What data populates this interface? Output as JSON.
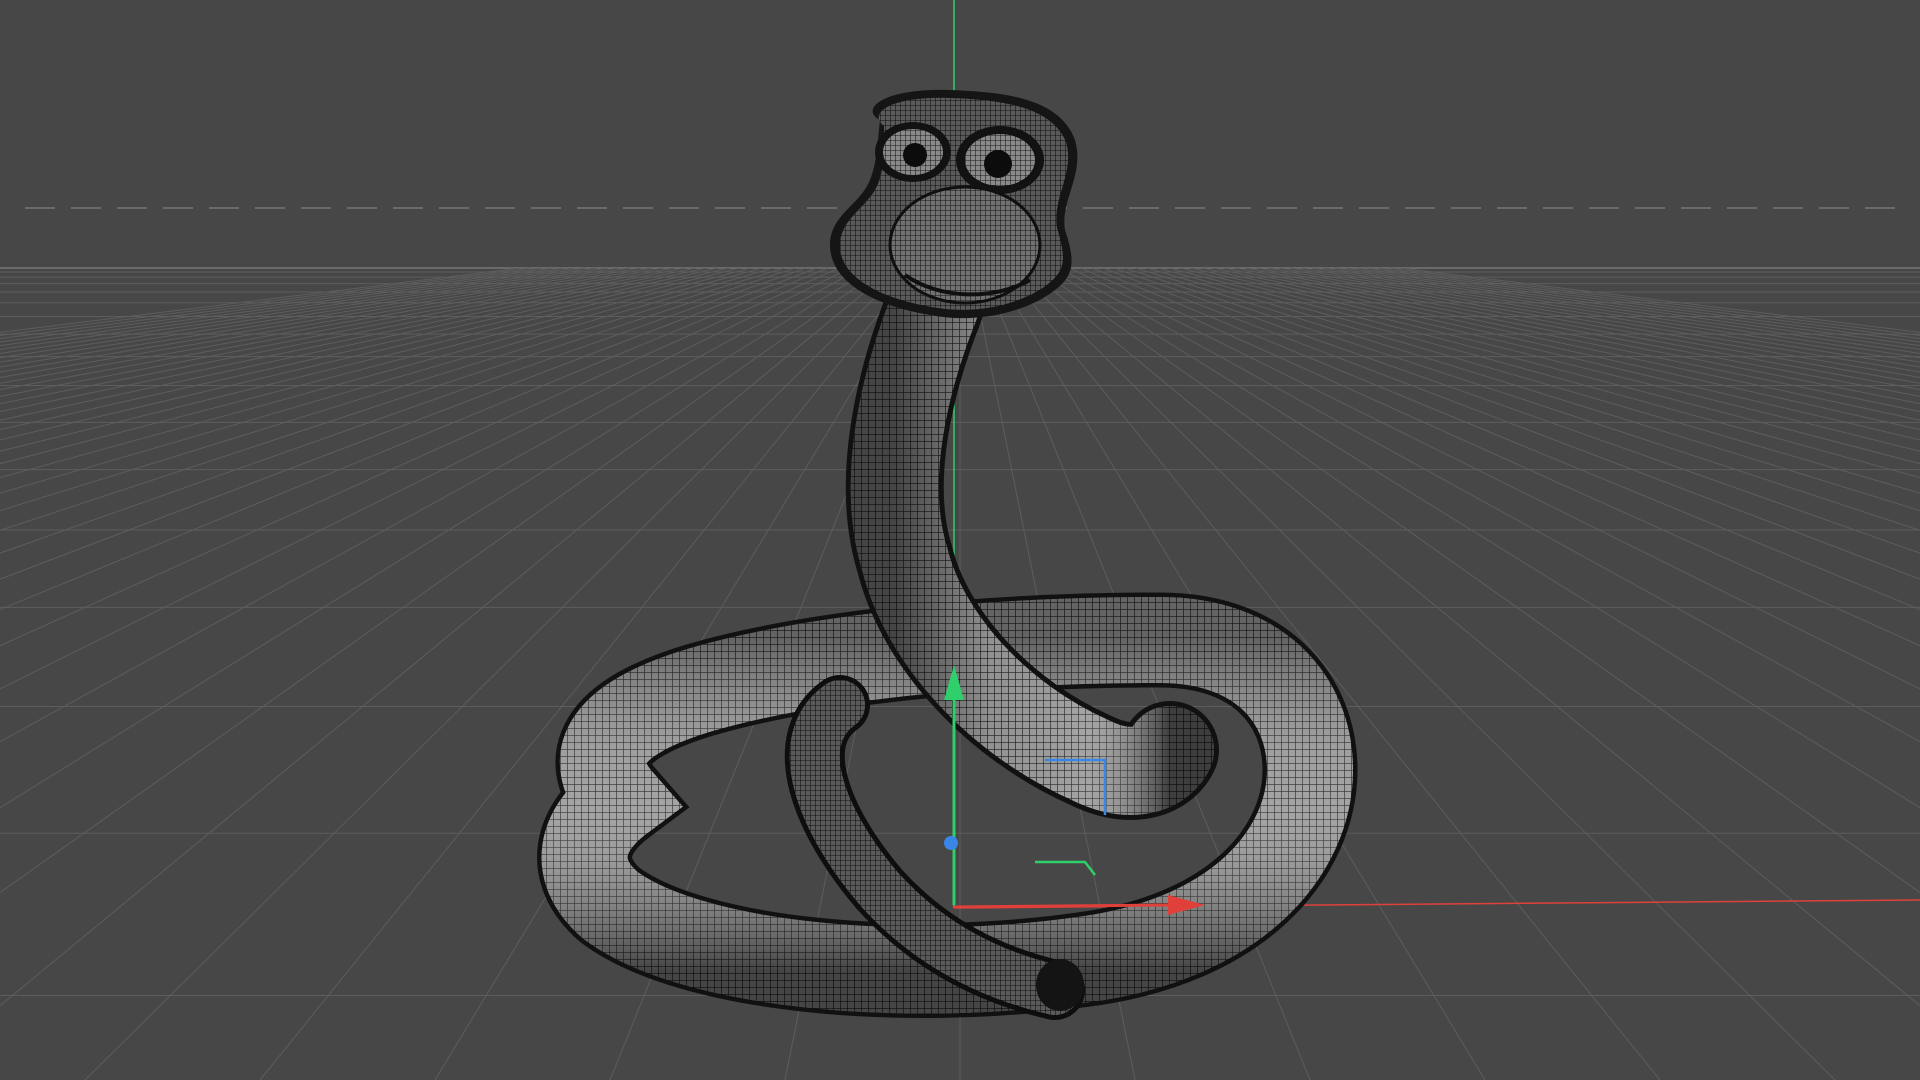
{
  "viewport": {
    "background": "#474747",
    "grid_color": "#5d5d5d",
    "horizon_color": "#6a6a6a",
    "grid_visible": true,
    "view": "perspective"
  },
  "axes": {
    "x_color": "#e0403a",
    "y_color": "#2fcf6b",
    "z_color": "#3a86e6"
  },
  "model": {
    "name": "snake",
    "display_mode": "wireframe-shaded",
    "surface_color": "#8e8e8e",
    "wire_color": "#1a1a1a"
  },
  "gizmo": {
    "type": "move",
    "icons": [
      "y-axis-arrow-icon",
      "x-axis-arrow-icon",
      "z-axis-handle-icon"
    ]
  }
}
